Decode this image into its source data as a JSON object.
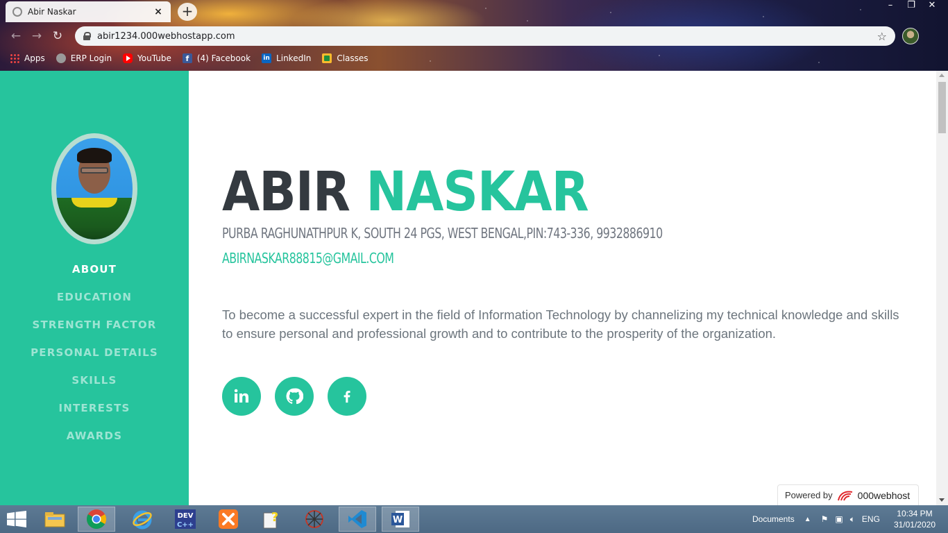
{
  "browser": {
    "tab_title": "Abir Naskar",
    "tab_close": "×",
    "new_tab": "+",
    "url": "abir1234.000webhostapp.com",
    "window_controls": [
      "–",
      "❐",
      "✕"
    ],
    "bookmarks": [
      {
        "label": "Apps",
        "icon": "apps-grid-icon"
      },
      {
        "label": "ERP Login",
        "icon": "erp-globe-icon"
      },
      {
        "label": "YouTube",
        "icon": "youtube-icon"
      },
      {
        "label": "(4) Facebook",
        "icon": "facebook-icon"
      },
      {
        "label": "LinkedIn",
        "icon": "linkedin-icon"
      },
      {
        "label": "Classes",
        "icon": "google-classroom-icon"
      }
    ]
  },
  "sidebar": {
    "nav": [
      {
        "label": "ABOUT",
        "active": true
      },
      {
        "label": "EDUCATION",
        "active": false
      },
      {
        "label": "STRENGTH FACTOR",
        "active": false
      },
      {
        "label": "PERSONAL DETAILS",
        "active": false
      },
      {
        "label": "SKILLS",
        "active": false
      },
      {
        "label": "INTERESTS",
        "active": false
      },
      {
        "label": "AWARDS",
        "active": false
      }
    ]
  },
  "profile": {
    "first_name": "ABIR",
    "last_name": "NASKAR",
    "address": "PURBA RAGHUNATHPUR K, SOUTH 24 PGS, WEST BENGAL,PIN:743-336, 9932886910",
    "email": "ABIRNASKAR88815@GMAIL.COM",
    "objective": "To become a successful expert in the field of Information Technology by channelizing my technical knowledge and skills to ensure personal and professional growth and to contribute to the prosperity of the organization.",
    "social": [
      {
        "name": "linkedin-icon"
      },
      {
        "name": "github-icon"
      },
      {
        "name": "facebook-icon"
      }
    ]
  },
  "host_badge": {
    "label": "Powered by",
    "brand": "000webhost"
  },
  "taskbar": {
    "documents_label": "Documents",
    "lang": "ENG",
    "time": "10:34 PM",
    "date": "31/01/2020"
  },
  "colors": {
    "accent": "#26c49d",
    "heading_dark": "#343a40",
    "muted_text": "#6c757d"
  }
}
